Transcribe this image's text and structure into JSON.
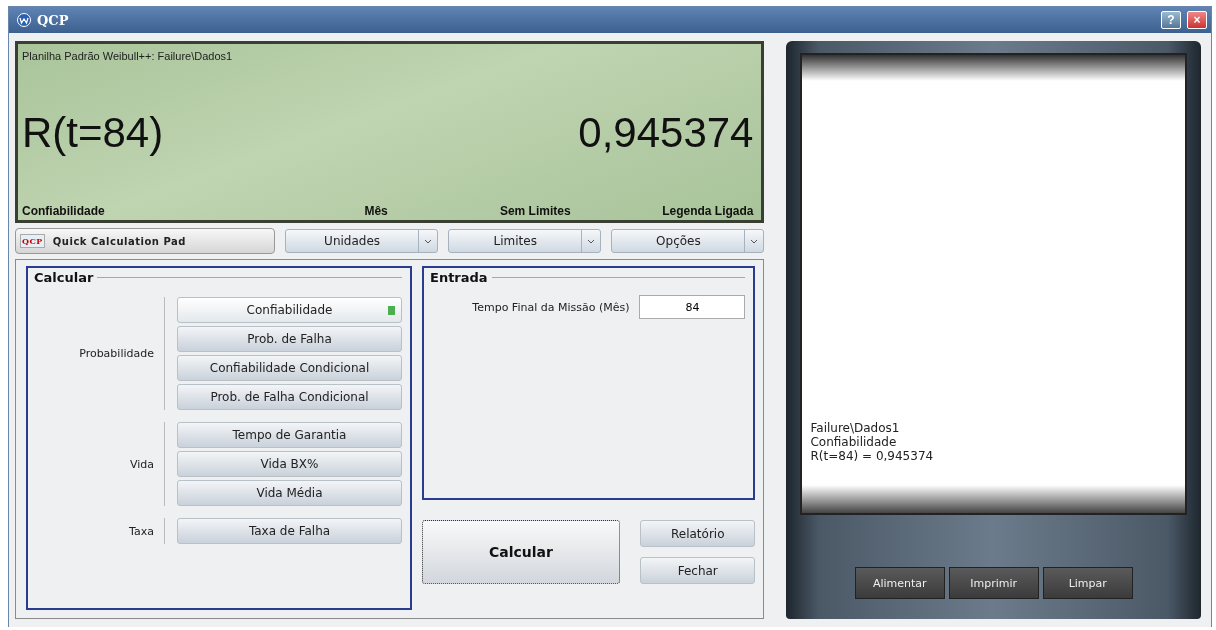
{
  "window": {
    "title": "QCP",
    "buttons": [
      "?",
      "×"
    ]
  },
  "display": {
    "source": "Planilha Padrão Weibull++: Failure\\Dados1",
    "expression": "R(t=84)",
    "result": "0,945374",
    "status": [
      "Confiabilidade",
      "Mês",
      "Sem Limites",
      "Legenda Ligada"
    ]
  },
  "toolbar": {
    "brand": "Quick Calculation Pad",
    "logo": "QCP",
    "dropdowns": [
      "Unidades",
      "Limites",
      "Opções"
    ]
  },
  "calculate": {
    "title": "Calcular",
    "groups": [
      {
        "label": "Probabilidade",
        "buttons": [
          {
            "label": "Confiabilidade",
            "selected": true
          },
          {
            "label": "Prob. de Falha",
            "selected": false
          },
          {
            "label": "Confiabilidade Condicional",
            "selected": false
          },
          {
            "label": "Prob. de Falha Condicional",
            "selected": false
          }
        ]
      },
      {
        "label": "Vida",
        "buttons": [
          {
            "label": "Tempo de Garantia",
            "selected": false
          },
          {
            "label": "Vida BX%",
            "selected": false
          },
          {
            "label": "Vida Média",
            "selected": false
          }
        ]
      },
      {
        "label": "Taxa",
        "buttons": [
          {
            "label": "Taxa de Falha",
            "selected": false
          }
        ]
      }
    ]
  },
  "input": {
    "title": "Entrada",
    "fields": [
      {
        "label": "Tempo Final da Missão (Mês)",
        "value": "84"
      }
    ]
  },
  "actions": {
    "primary": "Calcular",
    "secondary": [
      "Relatório",
      "Fechar"
    ]
  },
  "printer": {
    "lines": [
      "Failure\\Dados1",
      "Confiabilidade",
      "R(t=84) = 0,945374"
    ],
    "buttons": [
      "Alimentar",
      "Imprimir",
      "Limpar"
    ]
  }
}
